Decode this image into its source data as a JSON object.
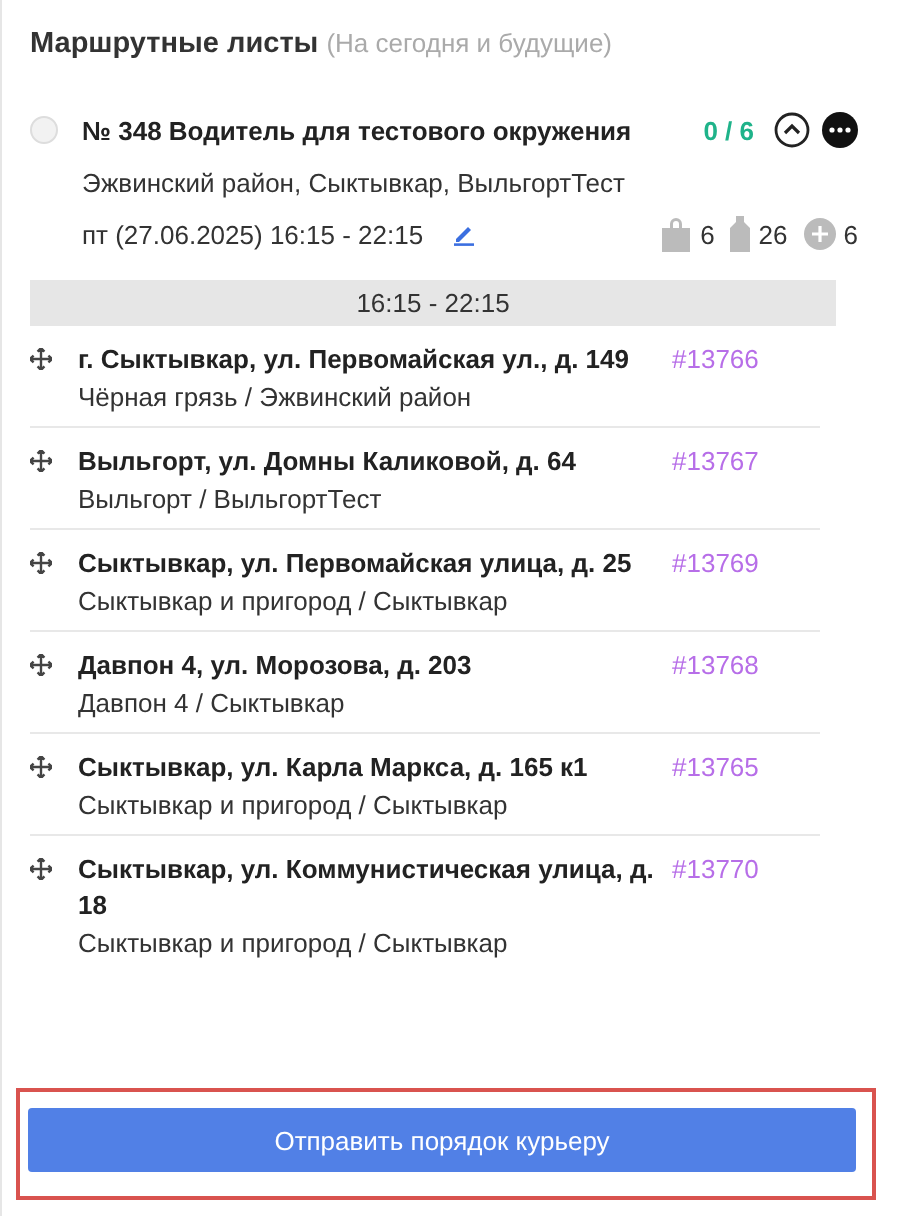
{
  "header": {
    "title": "Маршрутные листы",
    "subtitle": "(На сегодня и будущие)"
  },
  "route": {
    "checked": false,
    "title": "№ 348 Водитель для тестового окружения",
    "progress": "0 / 6",
    "expanded": true,
    "areas": "Эжвинский район, Сыктывкар, ВыльгортТест",
    "date": "пт (27.06.2025) 16:15 - 22:15",
    "stats": [
      {
        "kind": "bag",
        "value": "6"
      },
      {
        "kind": "bottle",
        "value": "26"
      },
      {
        "kind": "plus",
        "value": "6"
      }
    ]
  },
  "slot": {
    "label": "16:15 - 22:15"
  },
  "stops": [
    {
      "address": "г. Сыктывкар, ул. Первомайская ул., д. 149",
      "order": "#13766",
      "area": "Чёрная грязь / Эжвинский район"
    },
    {
      "address": "Выльгорт, ул. Домны Каликовой, д. 64",
      "order": "#13767",
      "area": "Выльгорт / ВыльгортТест"
    },
    {
      "address": "Сыктывкар, ул. Первомайская улица, д. 25",
      "order": "#13769",
      "area": "Сыктывкар и пригород / Сыктывкар"
    },
    {
      "address": "Давпон 4, ул. Морозова, д. 203",
      "order": "#13768",
      "area": "Давпон 4 / Сыктывкар"
    },
    {
      "address": "Сыктывкар, ул. Карла Маркса, д. 165 к1",
      "order": "#13765",
      "area": "Сыктывкар и пригород / Сыктывкар"
    },
    {
      "address": "Сыктывкар, ул. Коммунистическая улица, д. 18",
      "order": "#13770",
      "area": "Сыктывкар и пригород / Сыктывкар"
    }
  ],
  "send_button": {
    "label": "Отправить порядок курьеру",
    "highlighted": true
  }
}
